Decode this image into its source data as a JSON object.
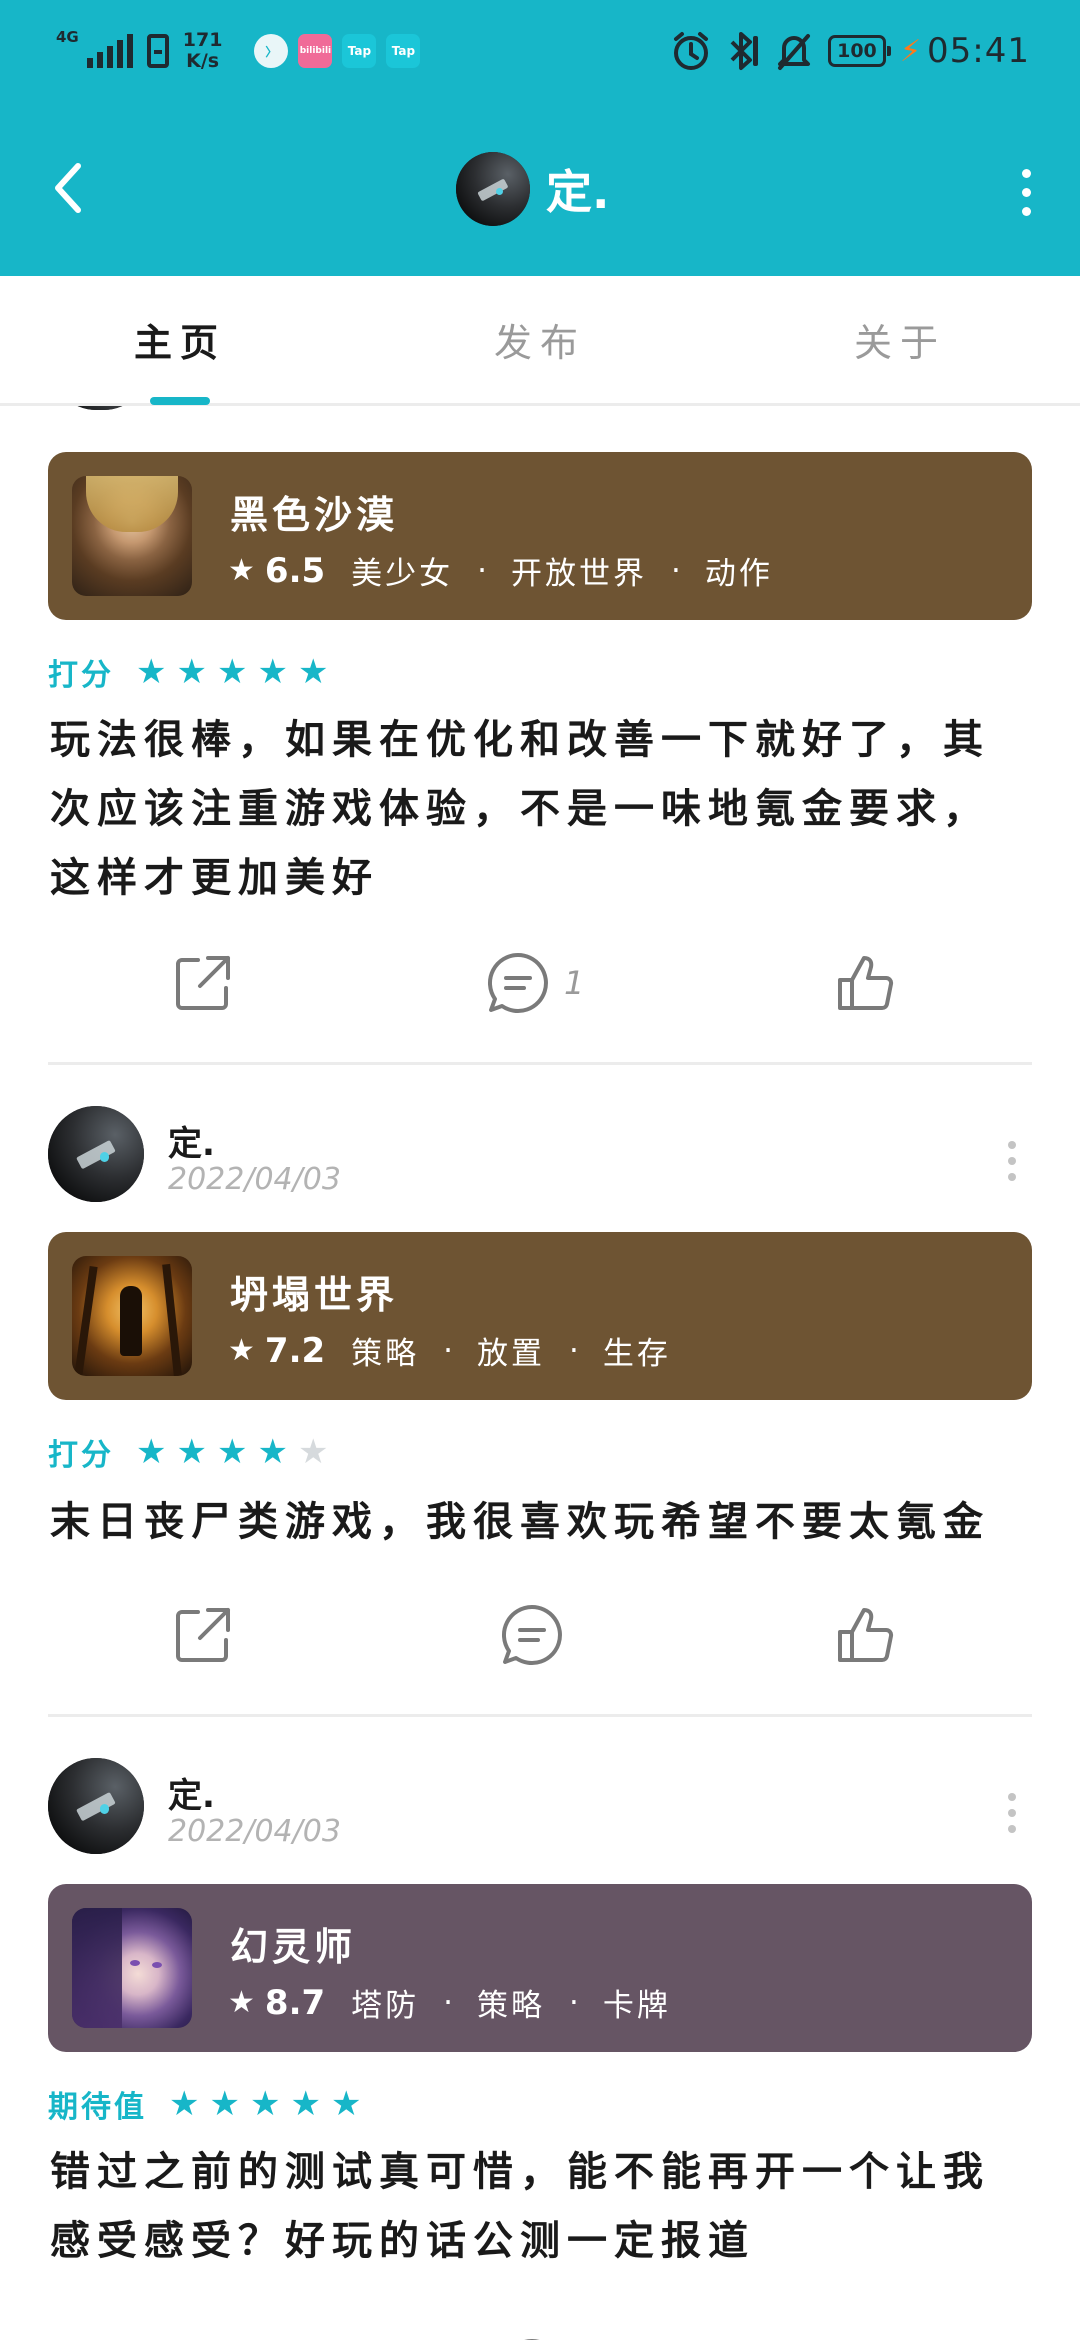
{
  "status_bar": {
    "network": "4G",
    "speed": "171\nK/s",
    "apps": [
      "〉",
      "bilibili",
      "Tap",
      "Tap"
    ],
    "battery": "100",
    "time": "05:41"
  },
  "header": {
    "title": "定.",
    "bg_color": "#17b6c8"
  },
  "tabs": [
    {
      "label": "主页",
      "active": true
    },
    {
      "label": "发布",
      "active": false
    },
    {
      "label": "关于",
      "active": false
    }
  ],
  "posts": [
    {
      "author": "",
      "date": "",
      "game": {
        "name": "黑色沙漠",
        "score": "6.5",
        "tags": [
          "美少女",
          "开放世界",
          "动作"
        ],
        "card_color": "#6e5433"
      },
      "rating_label": "打分",
      "stars": 5,
      "review": "玩法很棒，如果在优化和改善一下就好了，其次应该注重游戏体验，不是一味地氪金要求，这样才更加美好",
      "comment_count": "1"
    },
    {
      "author": "定.",
      "date": "2022/04/03",
      "game": {
        "name": "坍塌世界",
        "score": "7.2",
        "tags": [
          "策略",
          "放置",
          "生存"
        ],
        "card_color": "#6e5433"
      },
      "rating_label": "打分",
      "stars": 4,
      "review": "末日丧尸类游戏，我很喜欢玩希望不要太氪金",
      "comment_count": ""
    },
    {
      "author": "定.",
      "date": "2022/04/03",
      "game": {
        "name": "幻灵师",
        "score": "8.7",
        "tags": [
          "塔防",
          "策略",
          "卡牌"
        ],
        "card_color": "#665564"
      },
      "rating_label": "期待值",
      "stars": 5,
      "review": "错过之前的测试真可惜，能不能再开一个让我感受感受？好玩的话公测一定报道",
      "comment_count": ""
    }
  ]
}
